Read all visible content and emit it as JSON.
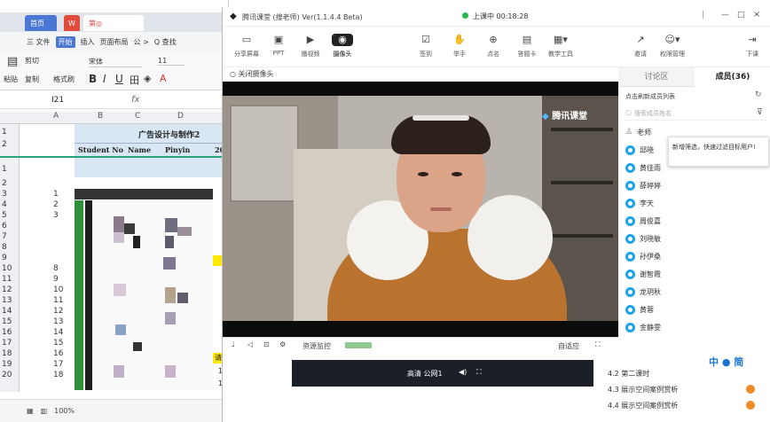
{
  "spreadsheet": {
    "tabs": {
      "home": "首页",
      "doc": "第◎"
    },
    "menu": [
      "三 文件",
      "开始",
      "插入",
      "页面布局",
      "公 >",
      "Q 查找"
    ],
    "ribbon": {
      "cut": "剪切",
      "paste": "粘贴",
      "copy": "复制",
      "format_painter": "格式刷",
      "font": "宋体",
      "size": "11",
      "bold": "B",
      "italic": "I",
      "underline": "U"
    },
    "cell_ref": "I21",
    "fx": "fx",
    "columns": [
      "A",
      "B",
      "C",
      "D"
    ],
    "title_cell": "广告设计与制作2",
    "headers": [
      "Student No",
      "Name",
      "Pinyin"
    ],
    "col_extra": "20",
    "row_numbers": [
      "1",
      "2",
      "1",
      "2",
      "3",
      "4",
      "5",
      "6",
      "7",
      "8",
      "9",
      "10",
      "11",
      "12",
      "13",
      "14",
      "15",
      "16",
      "17",
      "18",
      "19",
      "20"
    ],
    "col_a_values": [
      "1",
      "2",
      "3",
      "8",
      "9",
      "10",
      "11",
      "12",
      "13",
      "14",
      "15",
      "16",
      "17",
      "18"
    ],
    "yellow_cell": "请假)",
    "small_values": [
      "1",
      "1"
    ],
    "status": {
      "zoom": "100%"
    }
  },
  "app": {
    "title": "腾讯课堂 (搜老师) Ver(1.1.4.4 Beta)",
    "session_status": "上课中 00:18:28",
    "window_controls": [
      "|",
      "—",
      "□",
      "×"
    ],
    "toolbar": [
      {
        "label": "分享屏幕",
        "icon": "screen-share-icon"
      },
      {
        "label": "PPT",
        "icon": "ppt-icon"
      },
      {
        "label": "播视频",
        "icon": "video-icon"
      },
      {
        "label": "摄像头",
        "icon": "camera-icon"
      }
    ],
    "toolbar_right": [
      {
        "label": "签到",
        "icon": "checkin-icon"
      },
      {
        "label": "举手",
        "icon": "hand-icon"
      },
      {
        "label": "点名",
        "icon": "rollcall-icon"
      },
      {
        "label": "答题卡",
        "icon": "answer-card-icon"
      },
      {
        "label": "教学工具",
        "icon": "tools-icon"
      }
    ],
    "right_tools": [
      {
        "label": "邀请",
        "icon": "invite-icon"
      },
      {
        "label": "权限管理",
        "icon": "permission-icon"
      },
      {
        "label": "下课",
        "icon": "end-class-icon"
      }
    ],
    "close_camera": "关闭摄像头",
    "watermark": "腾讯课堂",
    "video_controls": {
      "label": "资源监控",
      "adapt": "自适应"
    },
    "subbar": {
      "text": "高清 公网1"
    },
    "panel_tabs": {
      "discussion": "讨论区",
      "members": "成员(36)"
    },
    "member_header": "点击刷新成员列表",
    "search_placeholder": "搜索成员姓名",
    "tooltip": "新增筛选，快速过滤目标用户!",
    "members": [
      "老师",
      "邱晓",
      "黄佳雨",
      "薛婷婷",
      "李天",
      "周俊嘉",
      "刘晓敏",
      "孙伊桑",
      "谢智霞",
      "龙玥秋",
      "黄蓉",
      "金静雯"
    ],
    "chapters": [
      "4.2 第二课时",
      "4.3 展示空间案例赏析",
      "4.4 展示空间案例赏析"
    ],
    "footer_logo": "中 ● 简"
  }
}
